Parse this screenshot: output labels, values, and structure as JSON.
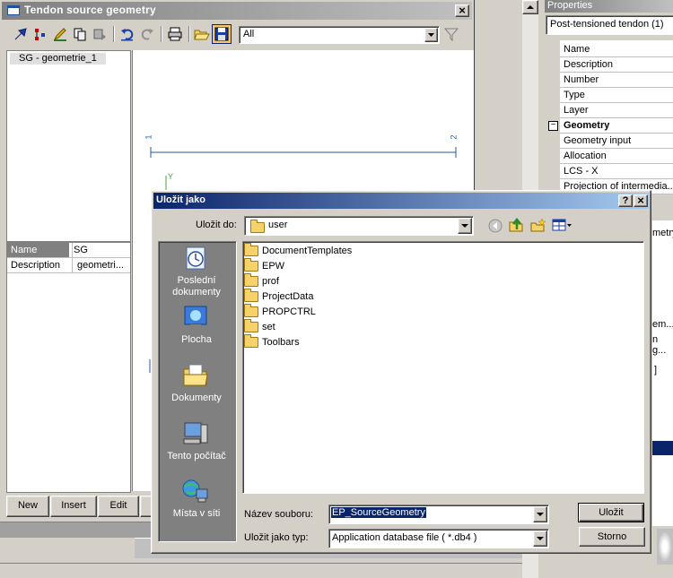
{
  "tendon_window": {
    "title": "Tendon source geometry",
    "filter_value": "All",
    "tree_item": "SG - geometrie_1",
    "node_label_1": "1",
    "node_label_2": "2",
    "axis_label_y": "Y",
    "mini_props": [
      {
        "name": "Name",
        "value": "SG"
      },
      {
        "name": "Description",
        "value": "geometri..."
      }
    ],
    "buttons": {
      "new": "New",
      "insert": "Insert",
      "edit": "Edit"
    }
  },
  "properties": {
    "title": "Properties",
    "selected_object": "Post-tensioned tendon (1)",
    "rows": [
      "Name",
      "Description",
      "Number",
      "Type",
      "Layer"
    ],
    "group_geometry": "Geometry",
    "group_rows": [
      "Geometry input",
      "Allocation",
      "LCS - X",
      "Projection of intermedia..."
    ],
    "right_fragments": [
      "metry",
      "em...",
      "n g...",
      "]"
    ]
  },
  "save_dialog": {
    "title": "Uložit jako",
    "help_button": "?",
    "close_button": "×",
    "save_in_label": "Uložit do:",
    "save_in_value": "user",
    "places": [
      {
        "label": "Poslední dokumenty",
        "icon": "recent-documents-icon"
      },
      {
        "label": "Plocha",
        "icon": "desktop-icon"
      },
      {
        "label": "Dokumenty",
        "icon": "my-documents-icon"
      },
      {
        "label": "Tento počítač",
        "icon": "my-computer-icon"
      },
      {
        "label": "Místa v síti",
        "icon": "network-places-icon"
      }
    ],
    "files": [
      "DocumentTemplates",
      "EPW",
      "prof",
      "ProjectData",
      "PROPCTRL",
      "set",
      "Toolbars"
    ],
    "filename_label": "Název souboru:",
    "filename_value": "EP_SourceGeometry",
    "filetype_label": "Uložit jako typ:",
    "filetype_value": "Application database file ( *.db4 )",
    "save_button": "Uložit",
    "cancel_button": "Storno"
  },
  "colors": {
    "active_title_start": "#0a246a",
    "active_title_end": "#a6caf0",
    "inactive_title_start": "#808080",
    "inactive_title_end": "#c0c0c0",
    "places_bar": "#808080",
    "selection": "#0a246a",
    "geometry_line": "#1f5aa6"
  }
}
